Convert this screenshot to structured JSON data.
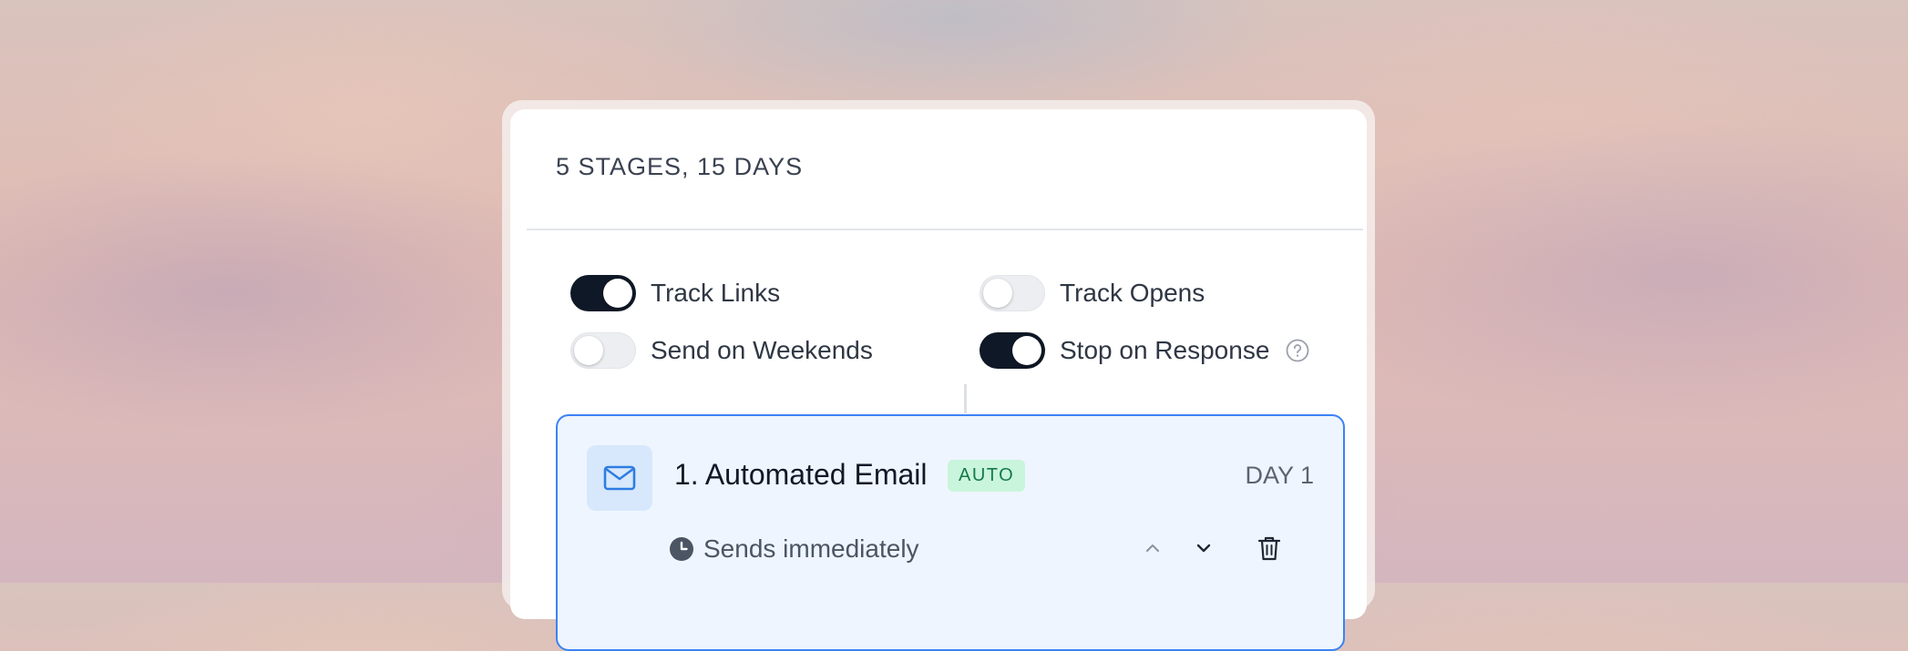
{
  "header": {
    "title": "5 STAGES, 15 DAYS"
  },
  "settings": {
    "track_links": {
      "label": "Track Links",
      "on": true
    },
    "track_opens": {
      "label": "Track Opens",
      "on": false
    },
    "send_on_weekends": {
      "label": "Send on Weekends",
      "on": false
    },
    "stop_on_response": {
      "label": "Stop on Response",
      "on": true
    }
  },
  "stage": {
    "title": "1. Automated Email",
    "badge": "AUTO",
    "day": "DAY 1",
    "schedule": "Sends immediately",
    "icon": "mail-icon"
  },
  "colors": {
    "toggle_on": "#0f1826",
    "toggle_off": "#eceef1",
    "stage_border": "#3b82f6",
    "stage_bg": "#eef5fe",
    "badge_bg": "#c9f5dc",
    "badge_text": "#16794a"
  }
}
